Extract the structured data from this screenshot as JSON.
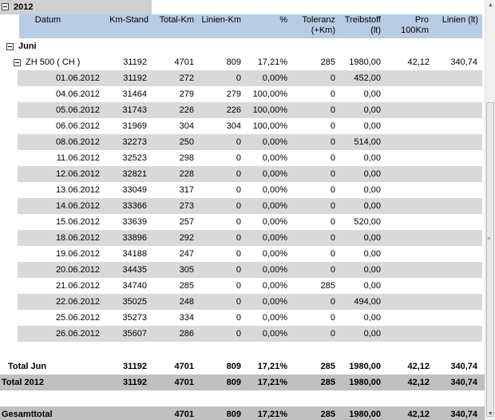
{
  "year_group": {
    "label": "2012"
  },
  "headers": [
    {
      "line1": "Datum",
      "line2": ""
    },
    {
      "line1": "Km-Stand",
      "line2": ""
    },
    {
      "line1": "Total-Km",
      "line2": ""
    },
    {
      "line1": "Linien-Km",
      "line2": ""
    },
    {
      "line1": "%",
      "line2": ""
    },
    {
      "line1": "Toleranz",
      "line2": "(+Km)"
    },
    {
      "line1": "Treibstoff",
      "line2": "(lt)"
    },
    {
      "line1": "Pro",
      "line2": "100Km"
    },
    {
      "line1": "Linien (lt)",
      "line2": ""
    }
  ],
  "month_group": {
    "label": "Juni"
  },
  "vehicle_group": {
    "label": "ZH 500 ( CH )",
    "values": [
      "31192",
      "4701",
      "809",
      "17,21%",
      "285",
      "1980,00",
      "42,12",
      "340,74"
    ]
  },
  "rows": [
    [
      "01.06.2012",
      "31192",
      "272",
      "0",
      "0,00%",
      "0",
      "452,00"
    ],
    [
      "04.06.2012",
      "31464",
      "279",
      "279",
      "100,00%",
      "0",
      "0,00"
    ],
    [
      "05.06.2012",
      "31743",
      "226",
      "226",
      "100,00%",
      "0",
      "0,00"
    ],
    [
      "06.06.2012",
      "31969",
      "304",
      "304",
      "100,00%",
      "0",
      "0,00"
    ],
    [
      "08.06.2012",
      "32273",
      "250",
      "0",
      "0,00%",
      "0",
      "514,00"
    ],
    [
      "11.06.2012",
      "32523",
      "298",
      "0",
      "0,00%",
      "0",
      "0,00"
    ],
    [
      "12.06.2012",
      "32821",
      "228",
      "0",
      "0,00%",
      "0",
      "0,00"
    ],
    [
      "13.06.2012",
      "33049",
      "317",
      "0",
      "0,00%",
      "0",
      "0,00"
    ],
    [
      "14.06.2012",
      "33366",
      "273",
      "0",
      "0,00%",
      "0",
      "0,00"
    ],
    [
      "15.06.2012",
      "33639",
      "257",
      "0",
      "0,00%",
      "0",
      "520,00"
    ],
    [
      "18.06.2012",
      "33896",
      "292",
      "0",
      "0,00%",
      "0",
      "0,00"
    ],
    [
      "19.06.2012",
      "34188",
      "247",
      "0",
      "0,00%",
      "0",
      "0,00"
    ],
    [
      "20.06.2012",
      "34435",
      "305",
      "0",
      "0,00%",
      "0",
      "0,00"
    ],
    [
      "21.06.2012",
      "34740",
      "285",
      "0",
      "0,00%",
      "285",
      "0,00"
    ],
    [
      "22.06.2012",
      "35025",
      "248",
      "0",
      "0,00%",
      "0",
      "494,00"
    ],
    [
      "25.06.2012",
      "35273",
      "334",
      "0",
      "0,00%",
      "0",
      "0,00"
    ],
    [
      "26.06.2012",
      "35607",
      "286",
      "0",
      "0,00%",
      "0",
      "0,00"
    ]
  ],
  "total_month": {
    "label": "Total Jun",
    "values": [
      "31192",
      "4701",
      "809",
      "17,21%",
      "285",
      "1980,00",
      "42,12",
      "340,74"
    ]
  },
  "total_year": {
    "label": "Total 2012",
    "values": [
      "31192",
      "4701",
      "809",
      "17,21%",
      "285",
      "1980,00",
      "42,12",
      "340,74"
    ]
  },
  "grand_total": {
    "label": "Gesamttotal",
    "values": [
      "",
      "4701",
      "809",
      "17,21%",
      "285",
      "1980,00",
      "42,12",
      "340,74"
    ]
  },
  "colors": {
    "header_bg": "#b8cce4",
    "stripe_bg": "#d9d9d9",
    "total_bg": "#c0c0c0",
    "year_bg": "#d0d0d0"
  }
}
